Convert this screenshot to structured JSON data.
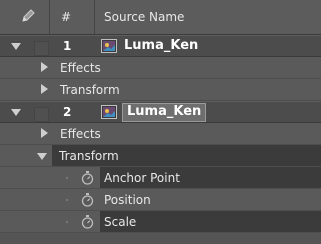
{
  "header": {
    "col_num": "#",
    "col_source": "Source Name"
  },
  "layers": [
    {
      "number": "1",
      "name": "Luma_Ken",
      "expanded": true
    },
    {
      "number": "2",
      "name": "Luma_Ken",
      "expanded": true,
      "editing": true
    }
  ],
  "props": {
    "effects": "Effects",
    "transform": "Transform",
    "anchor_point": "Anchor Point",
    "position": "Position",
    "scale": "Scale"
  },
  "colors": {
    "selected_row": "#3b3b3b",
    "panel": "#555555"
  },
  "icons": [
    "pencil-icon",
    "twirl-down-icon",
    "twirl-right-icon",
    "footage-icon",
    "stopwatch-icon"
  ]
}
